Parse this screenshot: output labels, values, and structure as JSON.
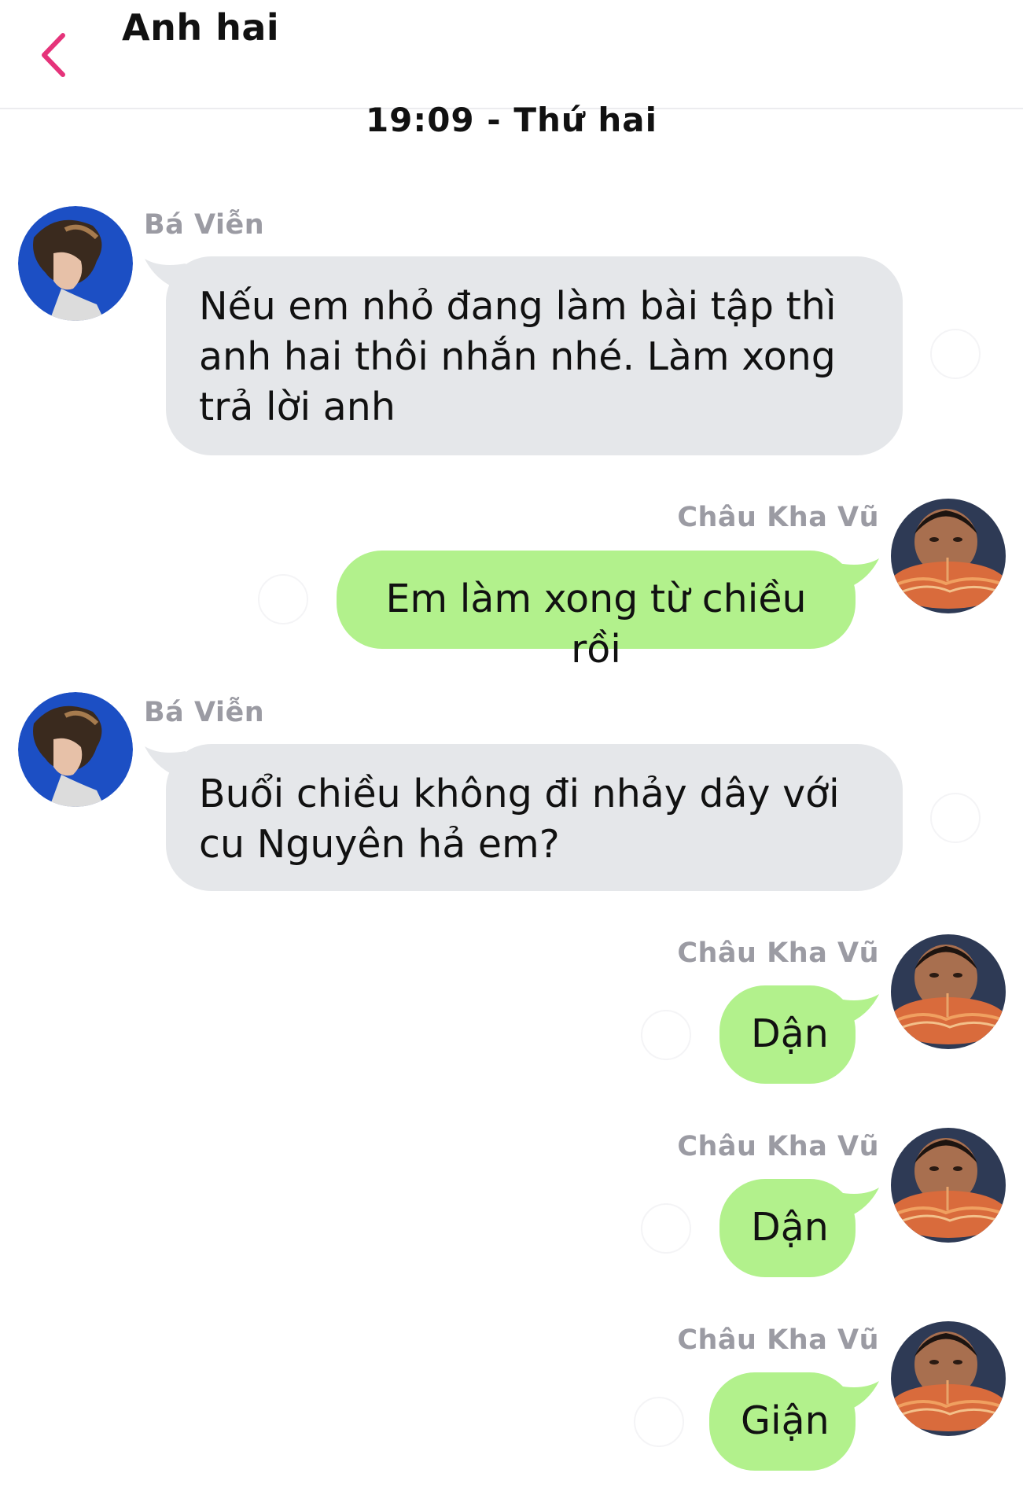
{
  "header": {
    "title": "Anh hai",
    "accent_color": "#e5337a",
    "back_icon": "chevron-left-icon"
  },
  "timestamp": "19:09 - Thứ hai",
  "colors": {
    "incoming_bubble": "#e5e7ea",
    "outgoing_bubble": "#b2f18c",
    "sender_name": "#9b9ba3"
  },
  "messages": [
    {
      "direction": "incoming",
      "sender": "Bá Viễn",
      "text": "Nếu em nhỏ đang làm bài tập thì anh hai thôi nhắn nhé. Làm xong trả lời anh"
    },
    {
      "direction": "outgoing",
      "sender": "Châu Kha Vũ",
      "text": "Em làm xong từ chiều rồi"
    },
    {
      "direction": "incoming",
      "sender": "Bá Viễn",
      "text": "Buổi chiều không đi nhảy dây với cu Nguyên hả em?"
    },
    {
      "direction": "outgoing",
      "sender": "Châu Kha Vũ",
      "text": "Dận"
    },
    {
      "direction": "outgoing",
      "sender": "Châu Kha Vũ",
      "text": "Dận"
    },
    {
      "direction": "outgoing",
      "sender": "Châu Kha Vũ",
      "text": "Giận"
    }
  ]
}
